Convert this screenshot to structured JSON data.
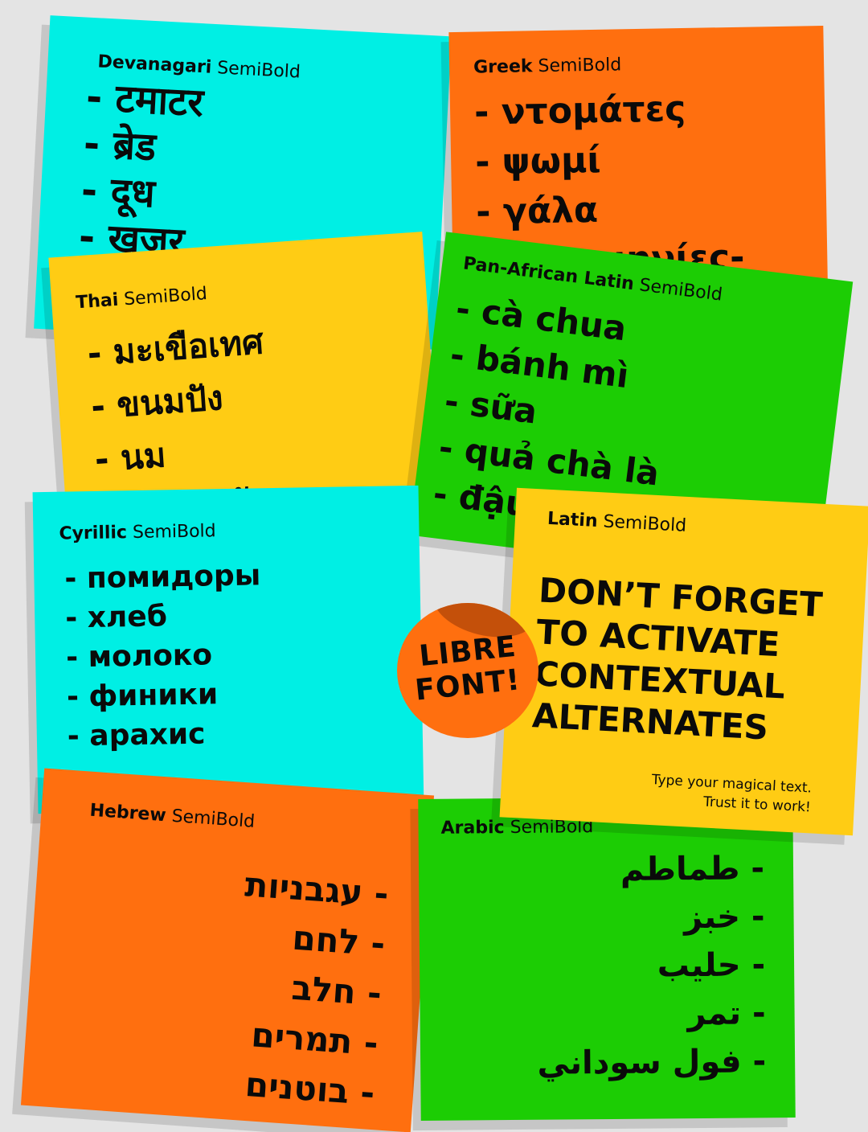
{
  "notes": {
    "devanagari": {
      "script": "Devanagari",
      "weight": "SemiBold",
      "items": [
        "- टमाटर",
        "- ब्रेड",
        "- दूध",
        "- खजूर"
      ]
    },
    "greek": {
      "script": "Greek",
      "weight": "SemiBold",
      "items": [
        "- ντομάτες",
        "- ψωμί",
        "- γάλα",
        "- χουρμηνίες-"
      ]
    },
    "thai": {
      "script": "Thai",
      "weight": "SemiBold",
      "items": [
        "- มะเขือเทศ",
        "- ขนมปัง",
        "- นม",
        "- อินทผาลัม"
      ]
    },
    "panafrican": {
      "script": "Pan-African Latin",
      "weight": "SemiBold",
      "items": [
        "- cà chua",
        "- bánh mì",
        "- sữa",
        "- quả chà là",
        "- đậu"
      ]
    },
    "cyrillic": {
      "script": "Cyrillic",
      "weight": "SemiBold",
      "items": [
        "- помидоры",
        "- хлеб",
        "- молоко",
        "- финики",
        "- арахис"
      ]
    },
    "latin": {
      "script": "Latin",
      "weight": "SemiBold",
      "headline": [
        "DON’T FORGET",
        "TO ACTIVATE",
        "CONTEXTUAL",
        "ALTERNATES"
      ],
      "tagline": [
        "Type your magical text.",
        "Trust it to work!"
      ]
    },
    "hebrew": {
      "script": "Hebrew",
      "weight": "SemiBold",
      "items": [
        "- עגבניות",
        "- לחם",
        "- חלב",
        "- תמרים",
        "- בוטנים"
      ]
    },
    "arabic": {
      "script": "Arabic",
      "weight": "SemiBold",
      "items": [
        "- طماطم",
        "- خبز",
        "- حليب",
        "- تمر",
        "- فول سوداني"
      ]
    }
  },
  "sticker": {
    "line1": "LIBRE",
    "line2": "FONT!"
  },
  "colors": {
    "background": "#e4e4e4",
    "cyan": "#00efe4",
    "orange": "#ff6f0f",
    "yellow": "#ffcc14",
    "green": "#1ccd04"
  }
}
